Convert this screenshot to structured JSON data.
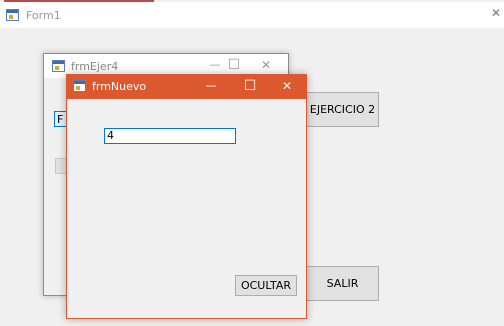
{
  "form1": {
    "title": "Form1",
    "close_glyph": "✕"
  },
  "frmEjer4": {
    "title": "frmEjer4",
    "minimize_glyph": "—",
    "maximize_glyph": "☐",
    "close_glyph": "✕",
    "partial_button_label": "F"
  },
  "frmNuevo": {
    "title": "frmNuevo",
    "minimize_glyph": "—",
    "maximize_glyph": "☐",
    "close_glyph": "✕",
    "text_value": "4",
    "ocultar_label": "OCULTAR"
  },
  "form1_buttons": {
    "ejercicio2_label": "EJERCICIO 2",
    "salir_label": "SALIR"
  },
  "colors": {
    "active_titlebar": "#dc5930",
    "inactive_titlebar": "#ffffff",
    "input_focus_border": "#0078d7",
    "form_background": "#f0f0f0"
  }
}
